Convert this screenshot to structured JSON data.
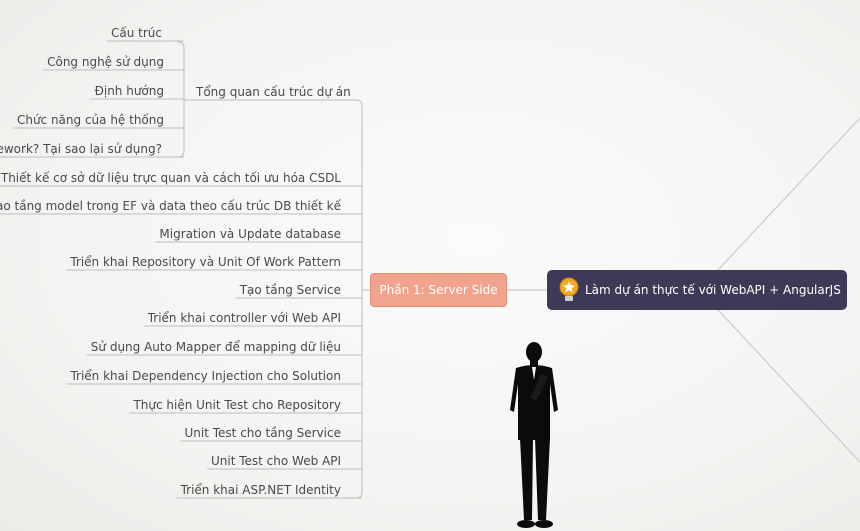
{
  "root": {
    "label": "Làm dự án thực tế với WebAPI + AngularJS",
    "icon": "lightbulb-icon"
  },
  "phase": {
    "label": "Phần 1: Server Side"
  },
  "overview": {
    "label": "Tổng quan cấu trúc dự án"
  },
  "overview_children": [
    "Cấu trúc",
    "Công nghệ sử dụng",
    "Định hướng",
    "Chức năng của hệ thống",
    "amework? Tại sao lại sử dụng?"
  ],
  "topics": [
    "Thiết kế cơ sở dữ liệu trực quan và cách tối ưu hóa CSDL",
    "Tạo tầng model trong EF và data theo cấu trúc DB thiết kế",
    "Migration và Update database",
    "Triển khai Repository và Unit Of Work Pattern",
    "Tạo tầng Service",
    "Triển khai controller với Web API",
    "Sử dụng Auto Mapper để mapping dữ liệu",
    "Triển khai Dependency Injection cho Solution",
    "Thực hiện Unit Test cho Repository",
    "Unit Test cho tầng Service",
    "Unit Test cho Web API",
    "Triển khai ASP.NET Identity"
  ],
  "colors": {
    "server_node": "#f2a38e",
    "root_node": "#3d3a57",
    "line": "#bdbdbd"
  }
}
